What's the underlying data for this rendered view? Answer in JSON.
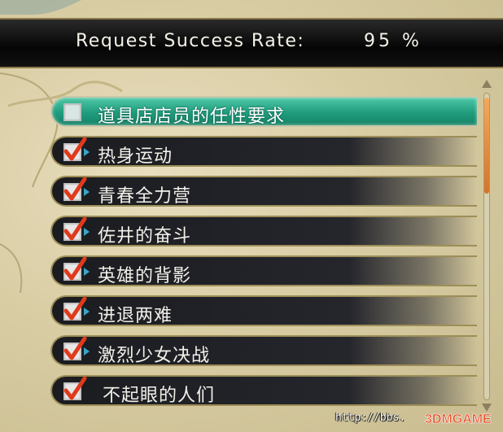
{
  "header": {
    "label": "Request Success Rate:",
    "value": "95 %"
  },
  "requests": [
    {
      "label": "道具店店员的任性要求",
      "checked": false,
      "selected": true
    },
    {
      "label": "热身运动",
      "checked": true,
      "selected": false
    },
    {
      "label": "青春全力营",
      "checked": true,
      "selected": false
    },
    {
      "label": "佐井的奋斗",
      "checked": true,
      "selected": false
    },
    {
      "label": "英雄的背影",
      "checked": true,
      "selected": false
    },
    {
      "label": "进退两难",
      "checked": true,
      "selected": false
    },
    {
      "label": "激烈少女决战",
      "checked": true,
      "selected": false
    },
    {
      "label": "不起眼的人们",
      "checked": true,
      "selected": false
    }
  ],
  "colors": {
    "selected_row": "#1f9c7d",
    "check_mark": "#e03a1c",
    "scroll_thumb": "#e08a3c",
    "pointer": "#38a6c9"
  },
  "icons": {
    "check": "check-mark-icon",
    "pointer": "pointer-triangle-icon",
    "scroll_up": "arrow-up-icon",
    "scroll_down": "arrow-down-icon"
  },
  "watermark": {
    "url": "http://bbs.",
    "logo": "3DMGAME"
  }
}
